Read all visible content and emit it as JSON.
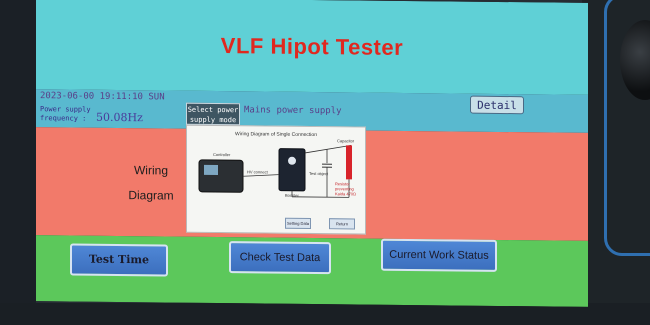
{
  "header": {
    "title": "VLF Hipot Tester"
  },
  "status": {
    "datetime": "2023-06-00 19:11:10 SUN",
    "freq_label": "Power supply frequency :",
    "freq_value": "50.08Hz",
    "mode_button": "Select power supply mode",
    "mode_value": "Mains power supply",
    "detail_button": "Detail"
  },
  "wiring": {
    "label_line1": "Wiring",
    "label_line2": "Diagram"
  },
  "popup": {
    "title": "Wiring Diagram of Single Connection",
    "labels": {
      "controller": "Controller",
      "hv_connect": "HV connect",
      "booster": "Booster",
      "test_object": "Test object",
      "capacitor": "Capacitor",
      "resistor": "Resistor preventing Kaida 470Ω"
    },
    "setting_button": "Setting Data",
    "return_button": "Return"
  },
  "buttons": {
    "test_time": "Test Time",
    "check_data": "Check Test Data",
    "work_status": "Current Work Status"
  },
  "colors": {
    "top_band": "#5fd0d6",
    "middle_band": "#f27a6a",
    "bottom_band": "#5cc85b",
    "title": "#e0281f",
    "button": "#4f87d6"
  }
}
